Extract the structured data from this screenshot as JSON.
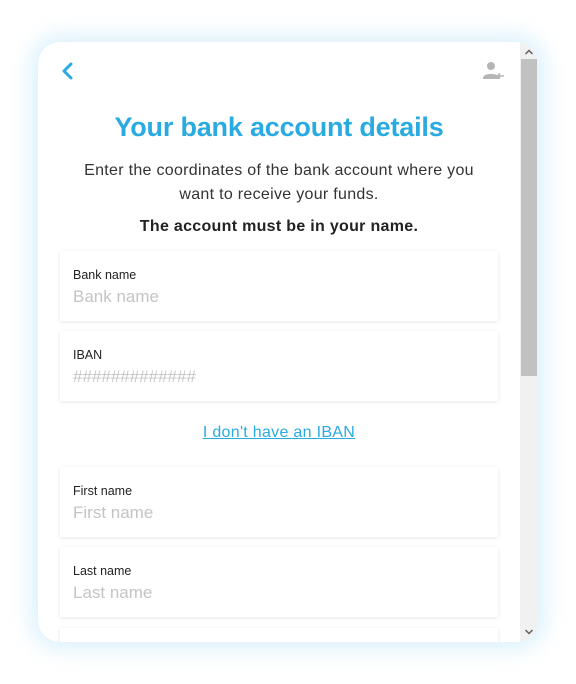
{
  "colors": {
    "accent": "#29abe2",
    "text": "#333333",
    "placeholder": "#c4c4c4",
    "scroll_thumb": "#c1c1c1"
  },
  "header": {
    "back_icon": "chevron-left-icon",
    "profile_icon": "user-logout-icon"
  },
  "page": {
    "title": "Your bank account details",
    "subtitle": "Enter the coordinates of the bank account where you want to receive your funds.",
    "note": "The account must be in your name."
  },
  "form": {
    "bank_name": {
      "label": "Bank name",
      "value": "",
      "placeholder": "Bank name"
    },
    "iban": {
      "label": "IBAN",
      "value": "",
      "placeholder": "#############"
    },
    "no_iban_link": "I don't have an IBAN",
    "first_name": {
      "label": "First name",
      "value": "",
      "placeholder": "First name"
    },
    "last_name": {
      "label": "Last name",
      "value": "",
      "placeholder": "Last name"
    }
  }
}
